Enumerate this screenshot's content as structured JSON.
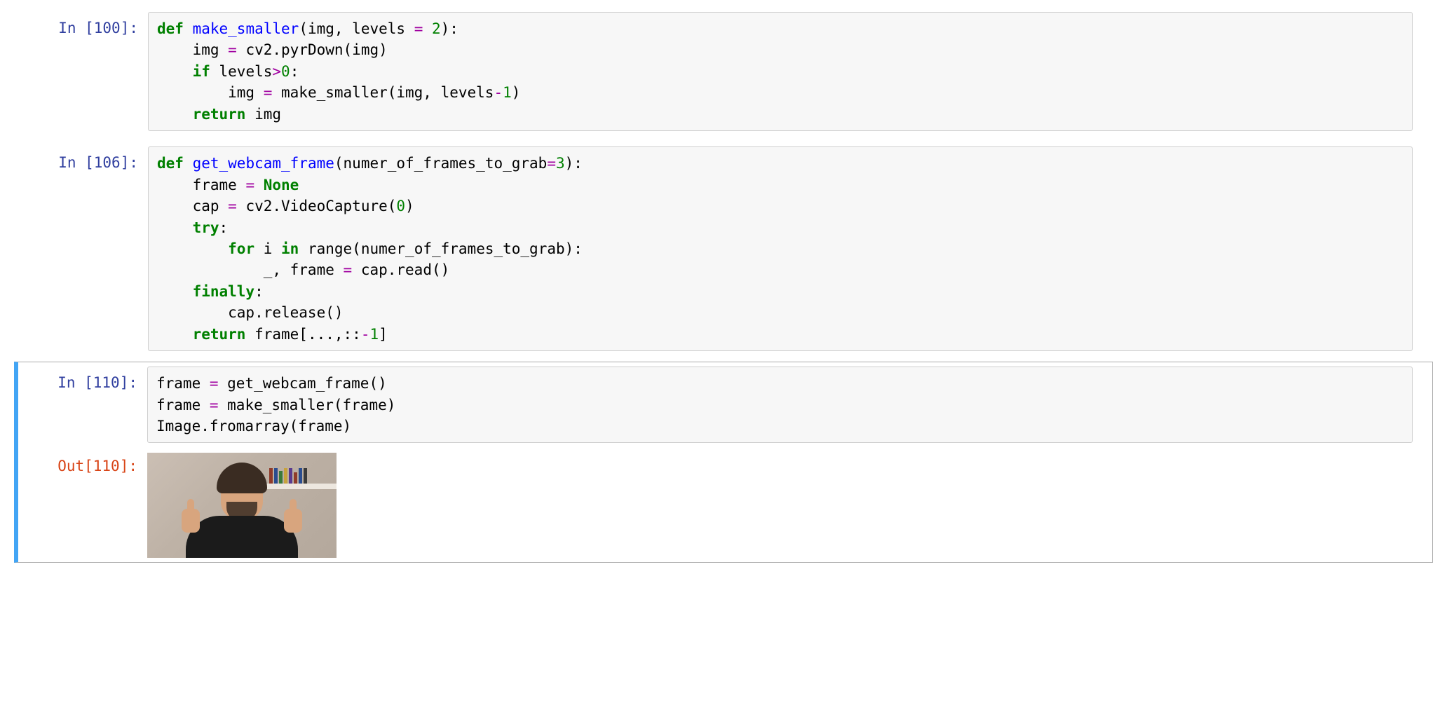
{
  "cells": [
    {
      "prompt_in": "In [100]:",
      "code_tokens": [
        {
          "c": "kw",
          "t": "def"
        },
        {
          "c": "plain",
          "t": " "
        },
        {
          "c": "fn",
          "t": "make_smaller"
        },
        {
          "c": "plain",
          "t": "(img, levels "
        },
        {
          "c": "op",
          "t": "="
        },
        {
          "c": "plain",
          "t": " "
        },
        {
          "c": "num",
          "t": "2"
        },
        {
          "c": "plain",
          "t": "):\n"
        },
        {
          "c": "plain",
          "t": "    img "
        },
        {
          "c": "op",
          "t": "="
        },
        {
          "c": "plain",
          "t": " cv2.pyrDown(img)\n"
        },
        {
          "c": "plain",
          "t": "    "
        },
        {
          "c": "kw",
          "t": "if"
        },
        {
          "c": "plain",
          "t": " levels"
        },
        {
          "c": "op",
          "t": ">"
        },
        {
          "c": "num",
          "t": "0"
        },
        {
          "c": "plain",
          "t": ":\n"
        },
        {
          "c": "plain",
          "t": "        img "
        },
        {
          "c": "op",
          "t": "="
        },
        {
          "c": "plain",
          "t": " make_smaller(img, levels"
        },
        {
          "c": "op",
          "t": "-"
        },
        {
          "c": "num",
          "t": "1"
        },
        {
          "c": "plain",
          "t": ")\n"
        },
        {
          "c": "plain",
          "t": "    "
        },
        {
          "c": "kw",
          "t": "return"
        },
        {
          "c": "plain",
          "t": " img"
        }
      ]
    },
    {
      "prompt_in": "In [106]:",
      "code_tokens": [
        {
          "c": "kw",
          "t": "def"
        },
        {
          "c": "plain",
          "t": " "
        },
        {
          "c": "fn",
          "t": "get_webcam_frame"
        },
        {
          "c": "plain",
          "t": "(numer_of_frames_to_grab"
        },
        {
          "c": "op",
          "t": "="
        },
        {
          "c": "num",
          "t": "3"
        },
        {
          "c": "plain",
          "t": "):\n"
        },
        {
          "c": "plain",
          "t": "    frame "
        },
        {
          "c": "op",
          "t": "="
        },
        {
          "c": "plain",
          "t": " "
        },
        {
          "c": "const",
          "t": "None"
        },
        {
          "c": "plain",
          "t": "\n"
        },
        {
          "c": "plain",
          "t": "    cap "
        },
        {
          "c": "op",
          "t": "="
        },
        {
          "c": "plain",
          "t": " cv2.VideoCapture("
        },
        {
          "c": "num",
          "t": "0"
        },
        {
          "c": "plain",
          "t": ")\n"
        },
        {
          "c": "plain",
          "t": "    "
        },
        {
          "c": "kw",
          "t": "try"
        },
        {
          "c": "plain",
          "t": ":\n"
        },
        {
          "c": "plain",
          "t": "        "
        },
        {
          "c": "kw",
          "t": "for"
        },
        {
          "c": "plain",
          "t": " i "
        },
        {
          "c": "kw",
          "t": "in"
        },
        {
          "c": "plain",
          "t": " range(numer_of_frames_to_grab):\n"
        },
        {
          "c": "plain",
          "t": "            _, frame "
        },
        {
          "c": "op",
          "t": "="
        },
        {
          "c": "plain",
          "t": " cap.read()\n"
        },
        {
          "c": "plain",
          "t": "    "
        },
        {
          "c": "kw",
          "t": "finally"
        },
        {
          "c": "plain",
          "t": ":\n"
        },
        {
          "c": "plain",
          "t": "        cap.release()\n"
        },
        {
          "c": "plain",
          "t": "    "
        },
        {
          "c": "kw",
          "t": "return"
        },
        {
          "c": "plain",
          "t": " frame[...,::"
        },
        {
          "c": "op",
          "t": "-"
        },
        {
          "c": "num",
          "t": "1"
        },
        {
          "c": "plain",
          "t": "]"
        }
      ]
    },
    {
      "selected": true,
      "prompt_in": "In [110]:",
      "code_tokens": [
        {
          "c": "plain",
          "t": "frame "
        },
        {
          "c": "op",
          "t": "="
        },
        {
          "c": "plain",
          "t": " get_webcam_frame()\n"
        },
        {
          "c": "plain",
          "t": "frame "
        },
        {
          "c": "op",
          "t": "="
        },
        {
          "c": "plain",
          "t": " make_smaller(frame)\n"
        },
        {
          "c": "plain",
          "t": "Image.fromarray(frame)"
        }
      ],
      "prompt_out": "Out[110]:",
      "output_type": "image"
    }
  ]
}
